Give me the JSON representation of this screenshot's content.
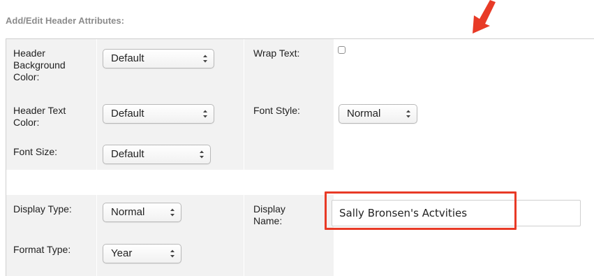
{
  "section": {
    "title": "Add/Edit Header Attributes:"
  },
  "fields": {
    "header_bg_color": {
      "label": "Header Background Color:",
      "value": "Default"
    },
    "wrap_text": {
      "label": "Wrap Text:",
      "checked": false
    },
    "header_text_color": {
      "label": "Header Text Color:",
      "value": "Default"
    },
    "font_style": {
      "label": "Font Style:",
      "value": "Normal"
    },
    "font_size": {
      "label": "Font Size:",
      "value": "Default"
    },
    "display_type": {
      "label": "Display Type:",
      "value": "Normal"
    },
    "display_name": {
      "label": "Display Name:",
      "value": "Sally Bronsen's Actvities"
    },
    "format_type": {
      "label": "Format Type:",
      "value": "Year"
    }
  },
  "colors": {
    "accent": "#e83a26",
    "cell_bg": "#f2f2f2"
  },
  "icons": {
    "arrow": "arrow-down-left-icon",
    "chevron": "up-down-chevron-icon"
  }
}
